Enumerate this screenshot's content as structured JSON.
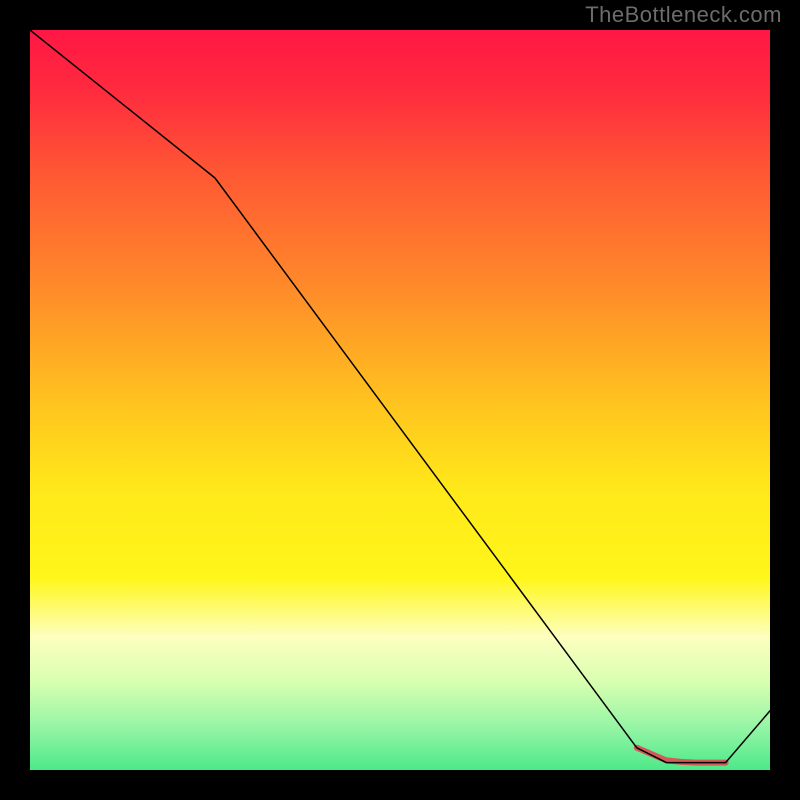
{
  "watermark": "TheBottleneck.com",
  "chart_data": {
    "type": "line",
    "title": "",
    "xlabel": "",
    "ylabel": "",
    "xlim": [
      0,
      100
    ],
    "ylim": [
      0,
      100
    ],
    "grid": false,
    "background_gradient": {
      "stops": [
        {
          "offset": 0.0,
          "color": "#ff1744"
        },
        {
          "offset": 0.08,
          "color": "#ff2a3f"
        },
        {
          "offset": 0.2,
          "color": "#ff5a33"
        },
        {
          "offset": 0.35,
          "color": "#ff8b2a"
        },
        {
          "offset": 0.5,
          "color": "#ffc21f"
        },
        {
          "offset": 0.62,
          "color": "#ffe81a"
        },
        {
          "offset": 0.74,
          "color": "#fff61a"
        },
        {
          "offset": 0.82,
          "color": "#fdffbf"
        },
        {
          "offset": 0.88,
          "color": "#d9ffb0"
        },
        {
          "offset": 0.94,
          "color": "#98f5a6"
        },
        {
          "offset": 1.0,
          "color": "#4de989"
        }
      ]
    },
    "series": [
      {
        "name": "curve",
        "color": "#000000",
        "width": 1.5,
        "x": [
          0,
          25,
          82,
          86,
          94,
          100
        ],
        "y": [
          100,
          80,
          3,
          1,
          1,
          8
        ]
      }
    ],
    "markers": {
      "name": "highlight-band",
      "color": "#d45a5a",
      "width": 6,
      "x": [
        82,
        85.5,
        86,
        88,
        90,
        92,
        93,
        94
      ],
      "y": [
        3,
        1.5,
        1.3,
        1.1,
        1.0,
        1.0,
        1.0,
        1.0
      ]
    }
  }
}
